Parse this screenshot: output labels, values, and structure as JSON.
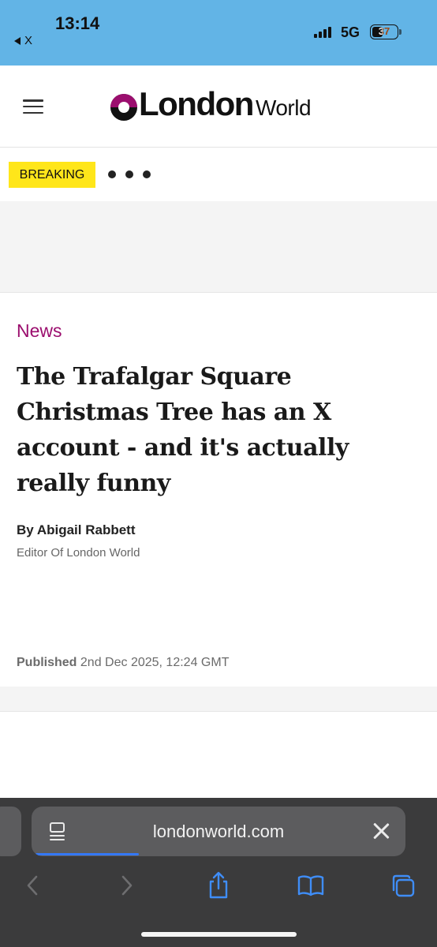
{
  "status_bar": {
    "time": "13:14",
    "back_app": "X",
    "network": "5G",
    "battery": "37"
  },
  "site": {
    "logo_bold": "London",
    "logo_light": "World",
    "breaking_label": "BREAKING"
  },
  "article": {
    "category": "News",
    "headline": "The Trafalgar Square Christmas Tree has an X account - and it's actually really funny",
    "byline": "By Abigail Rabbett",
    "author_role": "Editor Of London World",
    "published_label": "Published",
    "published_date": "2nd Dec 2025, 12:24 GMT"
  },
  "browser": {
    "url": "londonworld.com",
    "accent": "#3478f6"
  },
  "colors": {
    "status_bar": "#62b4e6",
    "brand": "#9b0e6e",
    "breaking": "#ffe61a"
  }
}
